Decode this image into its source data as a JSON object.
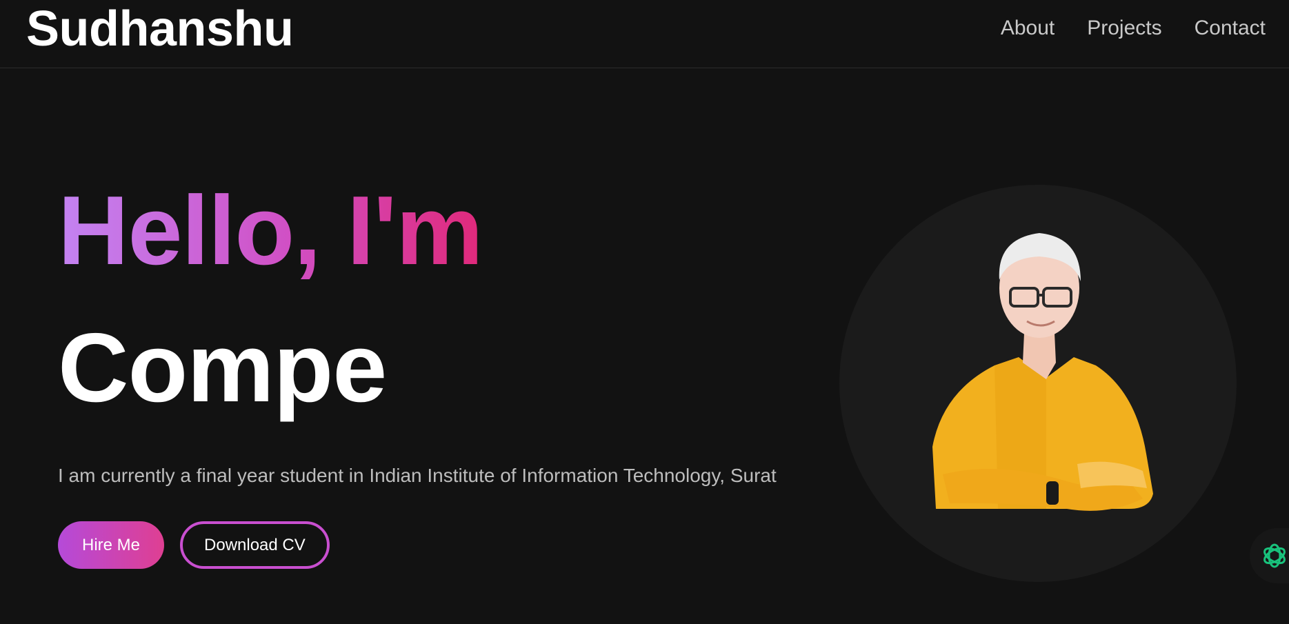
{
  "header": {
    "brand": "Sudhanshu",
    "nav": [
      {
        "label": "About"
      },
      {
        "label": "Projects"
      },
      {
        "label": "Contact"
      }
    ]
  },
  "hero": {
    "greeting": "Hello, I'm",
    "typed_text": "Compe",
    "bio": "I am currently a final year student in Indian Institute of Information Technology, Surat",
    "buttons": {
      "hire": "Hire Me",
      "cv": "Download CV"
    }
  },
  "colors": {
    "background": "#121212",
    "gradient_start": "#c383f2",
    "gradient_end": "#e0297a",
    "accent_outline": "#c94fd0",
    "assistant_icon": "#19c37d"
  },
  "icons": {
    "assistant": "openai-knot-icon"
  }
}
